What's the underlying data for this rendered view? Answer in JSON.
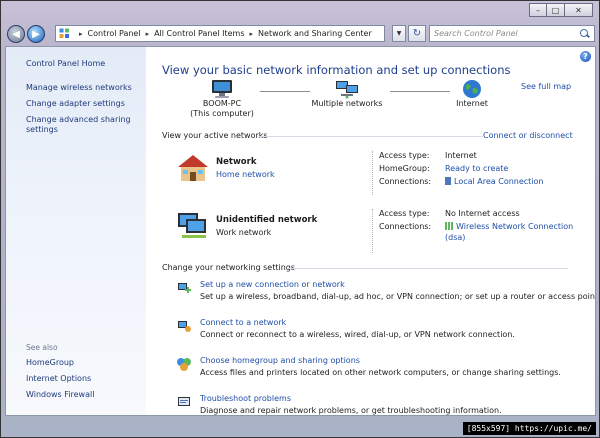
{
  "window": {
    "title": "Network and Sharing Center",
    "buttons": {
      "minimize": "–",
      "maximize": "□",
      "close": "✕"
    }
  },
  "nav": {
    "back_icon": "back-arrow-icon",
    "forward_icon": "forward-arrow-icon",
    "breadcrumbs": [
      "Control Panel",
      "All Control Panel Items",
      "Network and Sharing Center"
    ],
    "search_placeholder": "Search Control Panel"
  },
  "sidebar": {
    "home": "Control Panel Home",
    "items": [
      {
        "label": "Manage wireless networks"
      },
      {
        "label": "Change adapter settings"
      },
      {
        "label": "Change advanced sharing settings"
      }
    ],
    "see_also_title": "See also",
    "see_also": [
      {
        "label": "HomeGroup"
      },
      {
        "label": "Internet Options"
      },
      {
        "label": "Windows Firewall"
      }
    ]
  },
  "main": {
    "title": "View your basic network information and set up connections",
    "see_full_map": "See full map",
    "map": {
      "nodes": [
        {
          "label": "BOOM-PC",
          "sublabel": "(This computer)"
        },
        {
          "label": "Multiple networks",
          "sublabel": ""
        },
        {
          "label": "Internet",
          "sublabel": ""
        }
      ]
    },
    "active_title": "View your active networks",
    "connect_link": "Connect or disconnect",
    "networks": [
      {
        "name": "Network",
        "type": "Home network",
        "rows": [
          {
            "key": "Access type:",
            "value": "Internet",
            "link": false
          },
          {
            "key": "HomeGroup:",
            "value": "Ready to create",
            "link": true
          },
          {
            "key": "Connections:",
            "value": "Local Area Connection",
            "link": true
          }
        ]
      },
      {
        "name": "Unidentified network",
        "type": "Work network",
        "rows": [
          {
            "key": "Access type:",
            "value": "No Internet access",
            "link": false
          },
          {
            "key": "Connections:",
            "value": "Wireless Network Connection",
            "value2": "(dsa)",
            "link": true
          }
        ]
      }
    ],
    "settings_title": "Change your networking settings",
    "tasks": [
      {
        "title": "Set up a new connection or network",
        "desc": "Set up a wireless, broadband, dial-up, ad hoc, or VPN connection; or set up a router or access point."
      },
      {
        "title": "Connect to a network",
        "desc": "Connect or reconnect to a wireless, wired, dial-up, or VPN network connection."
      },
      {
        "title": "Choose homegroup and sharing options",
        "desc": "Access files and printers located on other network computers, or change sharing settings."
      },
      {
        "title": "Troubleshoot problems",
        "desc": "Diagnose and repair network problems, or get troubleshooting information."
      }
    ]
  },
  "watermark": "[855x597] https://upic.me/"
}
